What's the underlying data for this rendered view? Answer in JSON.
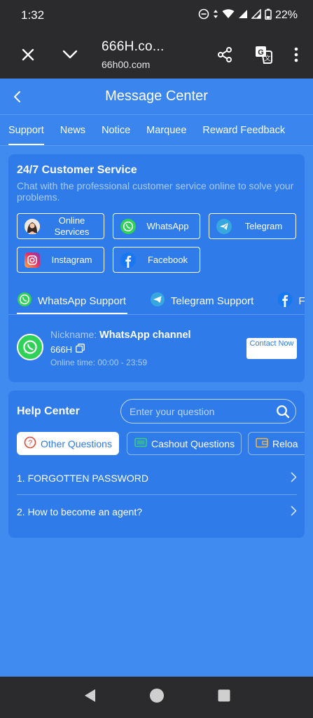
{
  "status_bar": {
    "time": "1:32",
    "battery": "22%"
  },
  "browser": {
    "title": "666H.co...",
    "url": "66h00.com"
  },
  "header": {
    "title": "Message Center"
  },
  "tabs": [
    {
      "label": "Support"
    },
    {
      "label": "News"
    },
    {
      "label": "Notice"
    },
    {
      "label": "Marquee"
    },
    {
      "label": "Reward Feedback"
    }
  ],
  "customer_service": {
    "title": "24/7 Customer Service",
    "subtitle": "Chat with the professional customer service online to solve your problems.",
    "buttons": [
      {
        "label": "Online Services",
        "icon": "avatar-icon"
      },
      {
        "label": "WhatsApp",
        "icon": "whatsapp-icon"
      },
      {
        "label": "Telegram",
        "icon": "telegram-icon"
      },
      {
        "label": "Instagram",
        "icon": "instagram-icon"
      },
      {
        "label": "Facebook",
        "icon": "facebook-icon"
      }
    ]
  },
  "support_tabs": [
    {
      "label": "WhatsApp Support"
    },
    {
      "label": "Telegram Support"
    },
    {
      "label": "F"
    }
  ],
  "channel": {
    "nickname_label": "Nickname:",
    "nickname": "WhatsApp channel",
    "code": "666H",
    "online_time": "Online time:  00:00 - 23:59",
    "contact_label": "Contact Now"
  },
  "help_center": {
    "title": "Help Center",
    "search_placeholder": "Enter your question",
    "question_tabs": [
      {
        "label": "Other Questions"
      },
      {
        "label": "Cashout Questions"
      },
      {
        "label": "Reloa"
      }
    ],
    "faq": [
      {
        "label": "1. FORGOTTEN PASSWORD"
      },
      {
        "label": "2. How to become an agent?"
      }
    ]
  },
  "colors": {
    "primary": "#3b86ee",
    "card": "#2f7be9",
    "whatsapp": "#2fd159",
    "telegram": "#37a7e0",
    "facebook": "#1877f2"
  }
}
